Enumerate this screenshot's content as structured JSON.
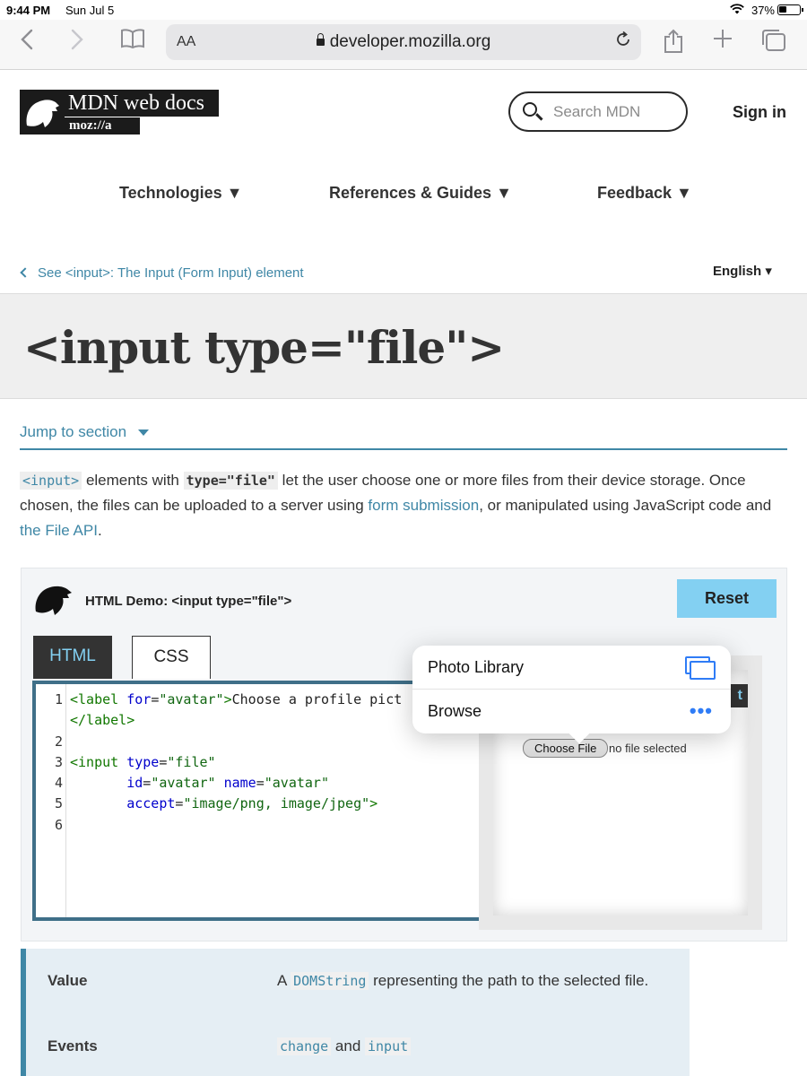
{
  "status_bar": {
    "time": "9:44 PM",
    "date": "Sun Jul 5",
    "battery": "37%"
  },
  "browser": {
    "text_size_label": "AA",
    "url": "developer.mozilla.org"
  },
  "header": {
    "logo_wordmark": "MDN web docs",
    "logo_sub": "moz://a",
    "search_placeholder": "Search MDN",
    "sign_in": "Sign in"
  },
  "nav": {
    "items": [
      {
        "label": "Technologies ▼"
      },
      {
        "label": "References & Guides ▼"
      },
      {
        "label": "Feedback ▼"
      }
    ]
  },
  "breadcrumb": {
    "text": "See <input>: The Input (Form Input) element"
  },
  "language": "English ▾",
  "page_title": "<input type=\"file\">",
  "jump": {
    "label": "Jump to section"
  },
  "intro": {
    "code_input": "<input>",
    "t1": " elements with ",
    "code_type": "type=\"file\"",
    "t2": " let the user choose one or more files from their device storage. Once chosen, the files can be uploaded to a server using ",
    "link_form": "form submission",
    "t3": ", or manipulated using JavaScript code and ",
    "link_api": "the File API",
    "t4": "."
  },
  "demo": {
    "title": "HTML Demo: <input type=\"file\">",
    "reset": "Reset",
    "tabs": [
      "HTML",
      "CSS"
    ],
    "line_numbers": [
      "1",
      "",
      "2",
      "3",
      "4",
      "5",
      "6"
    ],
    "choose_file": "Choose File",
    "no_file": "no file selected",
    "output_stub": "t"
  },
  "popover": {
    "items": [
      {
        "label": "Photo Library",
        "icon": "photo-library-icon"
      },
      {
        "label": "Browse",
        "icon": "more-icon"
      }
    ]
  },
  "properties": {
    "rows": [
      {
        "key": "Value",
        "pre": "A ",
        "code": "DOMString",
        "post": " representing the path to the selected file."
      },
      {
        "key": "Events",
        "code1": "change",
        "mid": " and ",
        "code2": "input"
      }
    ]
  },
  "colors": {
    "link": "#3f87a6",
    "reset_button": "#83d0f2",
    "popover_accent": "#2f7cf6"
  }
}
